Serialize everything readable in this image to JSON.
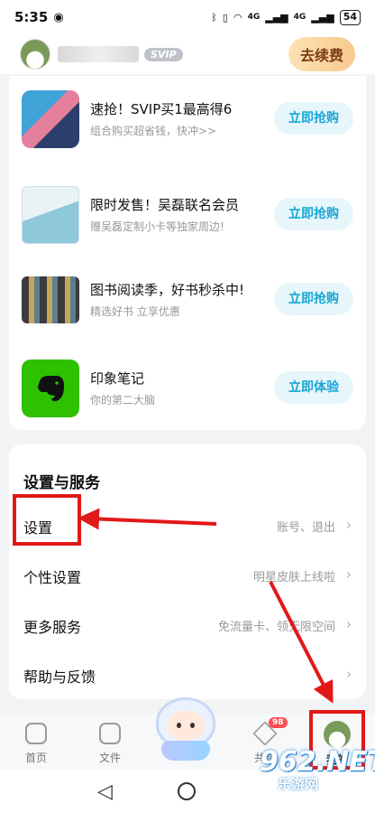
{
  "status_bar": {
    "time": "5:35",
    "signal1": "4G",
    "signal2": "4G",
    "battery": "54"
  },
  "header": {
    "vip_badge": "SVIP",
    "renew_label": "去续费"
  },
  "promos": [
    {
      "title": "速抢！SVIP买1最高得6",
      "subtitle": "组合购买超省钱，快冲>>",
      "button": "立即抢购"
    },
    {
      "title": "限时发售！吴磊联名会员",
      "subtitle": "赠吴磊定制小卡等独家周边!",
      "button": "立即抢购"
    },
    {
      "title": "图书阅读季，好书秒杀中!",
      "subtitle": "精选好书 立享优惠",
      "button": "立即抢购"
    },
    {
      "title": "印象笔记",
      "subtitle": "你的第二大脑",
      "button": "立即体验"
    }
  ],
  "settings": {
    "heading": "设置与服务",
    "rows": [
      {
        "label": "设置",
        "value": "账号、退出"
      },
      {
        "label": "个性设置",
        "value": "明星皮肤上线啦"
      },
      {
        "label": "更多服务",
        "value": "免流量卡、领无限空间"
      },
      {
        "label": "帮助与反馈",
        "value": ""
      }
    ]
  },
  "tabs": [
    {
      "label": "首页"
    },
    {
      "label": "文件"
    },
    {
      "label": "共享",
      "badge": "98"
    },
    {
      "label": "我的"
    }
  ],
  "watermark": {
    "main": "962.NET",
    "sub": "乐游网"
  },
  "colors": {
    "accent": "#17a6d6",
    "annotation": "#e21818",
    "renew_text": "#7a3d12"
  }
}
